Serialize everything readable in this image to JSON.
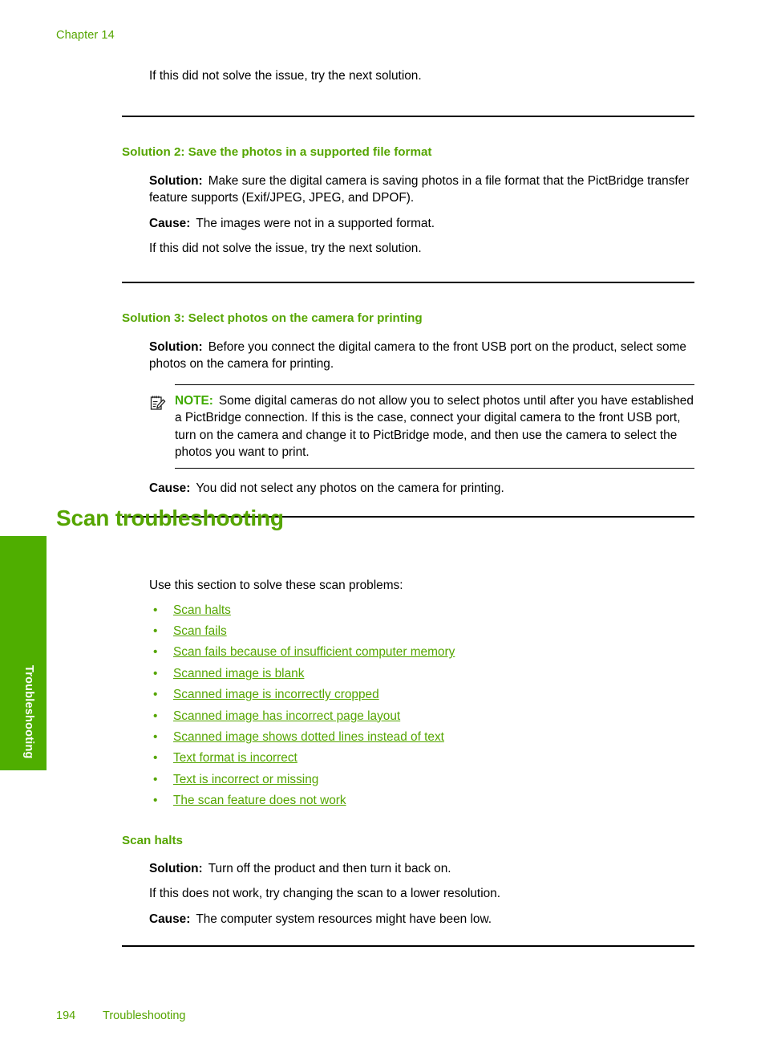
{
  "header": {
    "chapter": "Chapter 14"
  },
  "side_tab": {
    "label": "Troubleshooting",
    "color": "#4fae00",
    "text_color": "#ffffff"
  },
  "colors": {
    "accent_green": "#55a500",
    "note_green": "#3faa00",
    "heading_green": "#55a500",
    "rule": "#000000",
    "body": "#000000"
  },
  "intro": {
    "line": "If this did not solve the issue, try the next solution."
  },
  "solution2": {
    "heading": "Solution 2: Save the photos in a supported file format",
    "solution_label": "Solution:",
    "solution_text": "Make sure the digital camera is saving photos in a file format that the PictBridge transfer feature supports (Exif/JPEG, JPEG, and DPOF).",
    "cause_label": "Cause:",
    "cause_text": "The images were not in a supported format.",
    "footer_line": "If this did not solve the issue, try the next solution."
  },
  "solution3": {
    "heading": "Solution 3: Select photos on the camera for printing",
    "solution_label": "Solution:",
    "solution_text": "Before you connect the digital camera to the front USB port on the product, select some photos on the camera for printing.",
    "note_icon": "note-pencil-icon",
    "note_label": "NOTE:",
    "note_text": "Some digital cameras do not allow you to select photos until after you have established a PictBridge connection. If this is the case, connect your digital camera to the front USB port, turn on the camera and change it to PictBridge mode, and then use the camera to select the photos you want to print.",
    "cause_label": "Cause:",
    "cause_text": "You did not select any photos on the camera for printing."
  },
  "scan_section": {
    "title": "Scan troubleshooting",
    "intro": "Use this section to solve these scan problems:",
    "links": [
      "Scan halts",
      "Scan fails",
      "Scan fails because of insufficient computer memory",
      "Scanned image is blank",
      "Scanned image is incorrectly cropped",
      "Scanned image has incorrect page layout",
      "Scanned image shows dotted lines instead of text",
      "Text format is incorrect",
      "Text is incorrect or missing",
      "The scan feature does not work"
    ]
  },
  "scan_halts": {
    "heading": "Scan halts",
    "solution_label": "Solution:",
    "solution_text": "Turn off the product and then turn it back on.",
    "extra_line": "If this does not work, try changing the scan to a lower resolution.",
    "cause_label": "Cause:",
    "cause_text": "The computer system resources might have been low."
  },
  "footer": {
    "page_number": "194",
    "section": "Troubleshooting"
  }
}
